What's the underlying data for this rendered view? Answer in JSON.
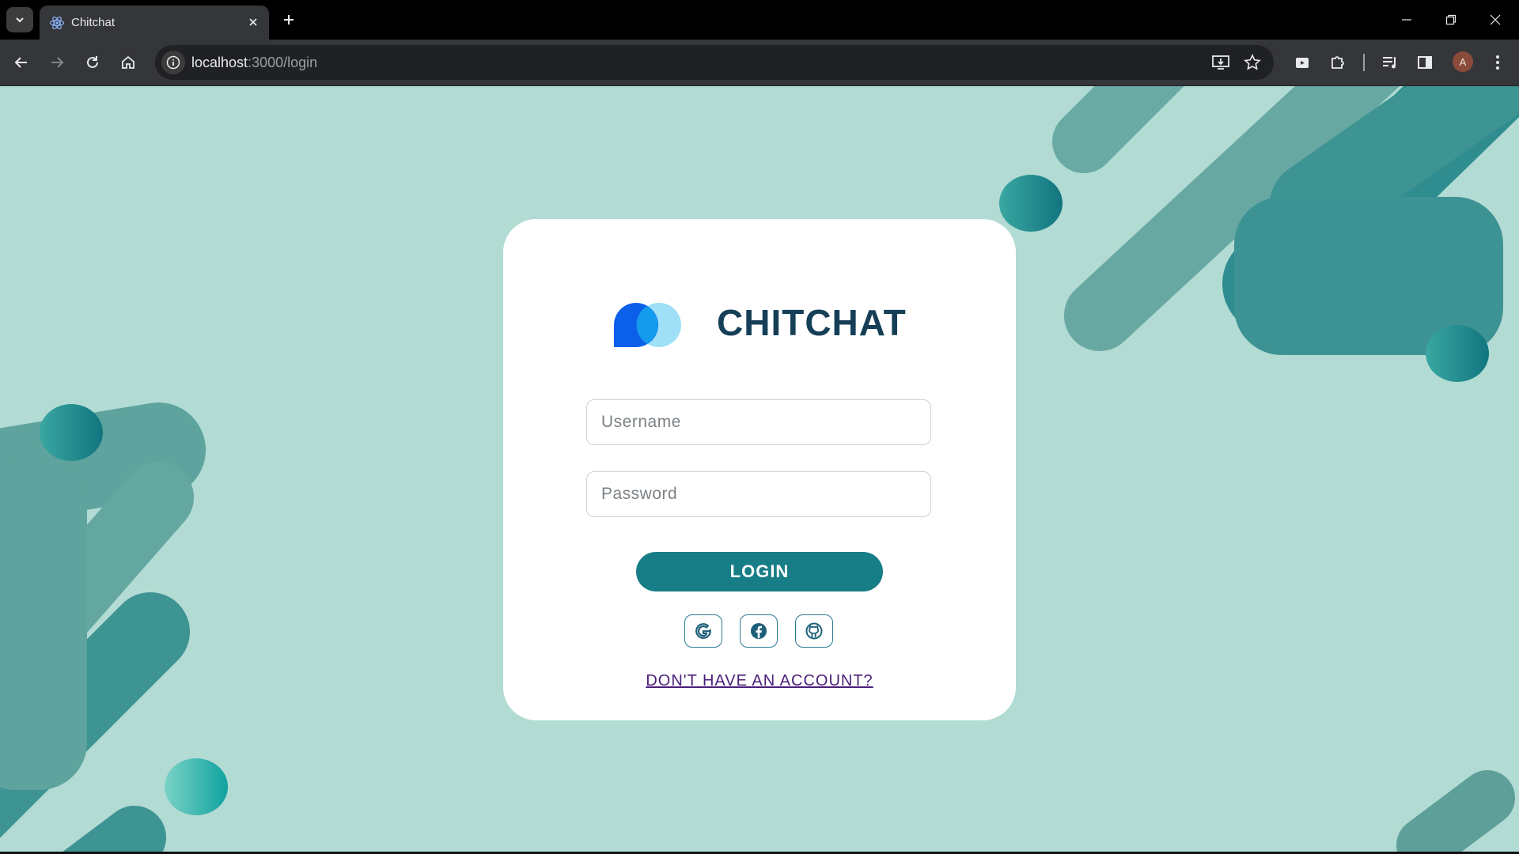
{
  "browser": {
    "tab_title": "Chitchat",
    "url_host": "localhost",
    "url_path": ":3000/login",
    "profile_initial": "A"
  },
  "login_page": {
    "brand_name": "CHITCHAT",
    "username_placeholder": "Username",
    "password_placeholder": "Password",
    "login_label": "LOGIN",
    "social_providers": [
      "google",
      "facebook",
      "github"
    ],
    "signup_link": "DON'T HAVE AN ACCOUNT?"
  },
  "colors": {
    "background": "#b2dbd3",
    "accent": "#177d86",
    "brand_text": "#163f57",
    "link": "#4b1f7a"
  }
}
